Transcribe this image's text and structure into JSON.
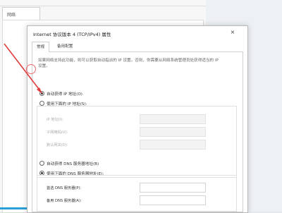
{
  "background_window": {
    "tab_label": "网络"
  },
  "dialog": {
    "title": "Internet 协议版本 4 (TCP/IPv4) 属性",
    "close_glyph": "×",
    "tabs": [
      {
        "label": "常规",
        "active": true
      },
      {
        "label": "备用配置",
        "active": false
      }
    ],
    "description": "如果网络支持此功能，则可以获取自动指派的 IP 设置。否则，你需要从网络系统管理员处获得适当的 IP 设置。",
    "ip": {
      "auto_label": "自动获得 IP 地址(O)",
      "auto_checked": true,
      "manual_label": "使用下面的 IP 地址(S):",
      "manual_checked": false,
      "fields": [
        {
          "label": "IP 地址(I):",
          "value": ""
        },
        {
          "label": "子网掩码(U):",
          "value": ""
        },
        {
          "label": "默认网关(D):",
          "value": ""
        }
      ]
    },
    "dns": {
      "auto_label": "自动获得 DNS 服务器地址(B)",
      "auto_checked": false,
      "manual_label": "使用下面的 DNS 服务器地址(E):",
      "manual_checked": true,
      "fields": [
        {
          "label": "首选 DNS 服务器(P):",
          "value": ""
        },
        {
          "label": "备用 DNS 服务器(A):",
          "value": ""
        }
      ]
    }
  },
  "colors": {
    "annotation_red": "#e03c3c",
    "taskbar_accent": "#2aa0d8"
  }
}
